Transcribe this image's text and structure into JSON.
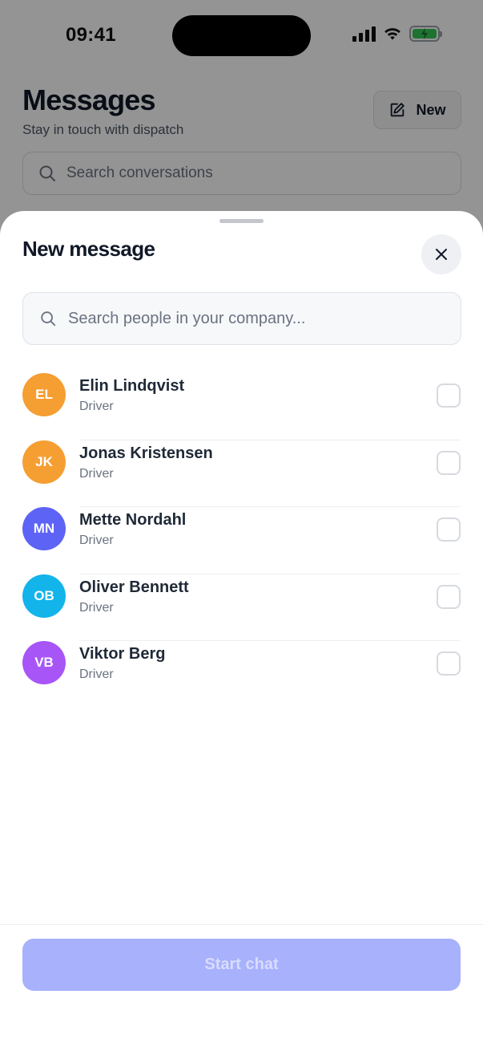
{
  "status_bar": {
    "time": "09:41"
  },
  "background": {
    "title": "Messages",
    "subtitle": "Stay in touch with dispatch",
    "new_button_label": "New",
    "search_placeholder": "Search conversations"
  },
  "sheet": {
    "title": "New message",
    "search_placeholder": "Search people in your company...",
    "people": [
      {
        "initials": "EL",
        "name": "Elin Lindqvist",
        "role": "Driver",
        "avatar_color": "#f59e32"
      },
      {
        "initials": "JK",
        "name": "Jonas Kristensen",
        "role": "Driver",
        "avatar_color": "#f59e32"
      },
      {
        "initials": "MN",
        "name": "Mette Nordahl",
        "role": "Driver",
        "avatar_color": "#5c63f5"
      },
      {
        "initials": "OB",
        "name": "Oliver Bennett",
        "role": "Driver",
        "avatar_color": "#12b4ea"
      },
      {
        "initials": "VB",
        "name": "Viktor Berg",
        "role": "Driver",
        "avatar_color": "#a855f7"
      }
    ],
    "start_button_label": "Start chat"
  },
  "colors": {
    "primary_disabled": "#a7b1fc",
    "overlay": "rgba(0,0,0,0.42)"
  }
}
